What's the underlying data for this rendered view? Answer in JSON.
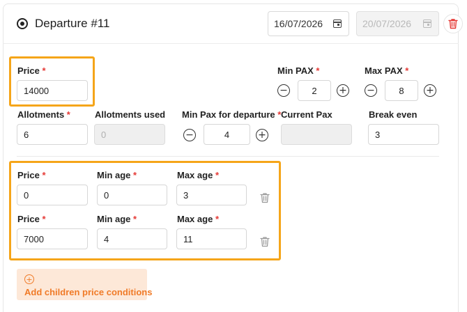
{
  "departure": {
    "title": "Departure #11",
    "start_date": "16/07/2026",
    "end_date": "20/07/2026",
    "icons": {
      "radio": "radio-selected-icon",
      "calendar": "calendar-icon",
      "delete": "trash-icon"
    },
    "colors": {
      "delete": "#e53935",
      "highlight": "#f5a519",
      "required": "#e53935",
      "accent": "#f07b28"
    }
  },
  "pricing": {
    "price": {
      "label": "Price",
      "value": "14000"
    },
    "min_pax": {
      "label": "Min PAX",
      "value": "2"
    },
    "max_pax": {
      "label": "Max PAX",
      "value": "8"
    },
    "required_mark": "*",
    "minus_symbol": "−",
    "plus_symbol": "+"
  },
  "allotments": {
    "allotments": {
      "label": "Allotments",
      "value": "6"
    },
    "allotments_used": {
      "label": "Allotments used",
      "value": "0"
    },
    "min_pax_departure": {
      "label": "Min Pax for departure",
      "value": "4"
    },
    "current_pax": {
      "label": "Current Pax",
      "value": ""
    },
    "break_even": {
      "label": "Break even",
      "value": "3"
    }
  },
  "children_conditions": {
    "labels": {
      "price": "Price",
      "min_age": "Min age",
      "max_age": "Max age"
    },
    "rows": [
      {
        "price": "0",
        "min_age": "0",
        "max_age": "3"
      },
      {
        "price": "7000",
        "min_age": "4",
        "max_age": "11"
      }
    ],
    "add_label": "Add children price conditions"
  }
}
